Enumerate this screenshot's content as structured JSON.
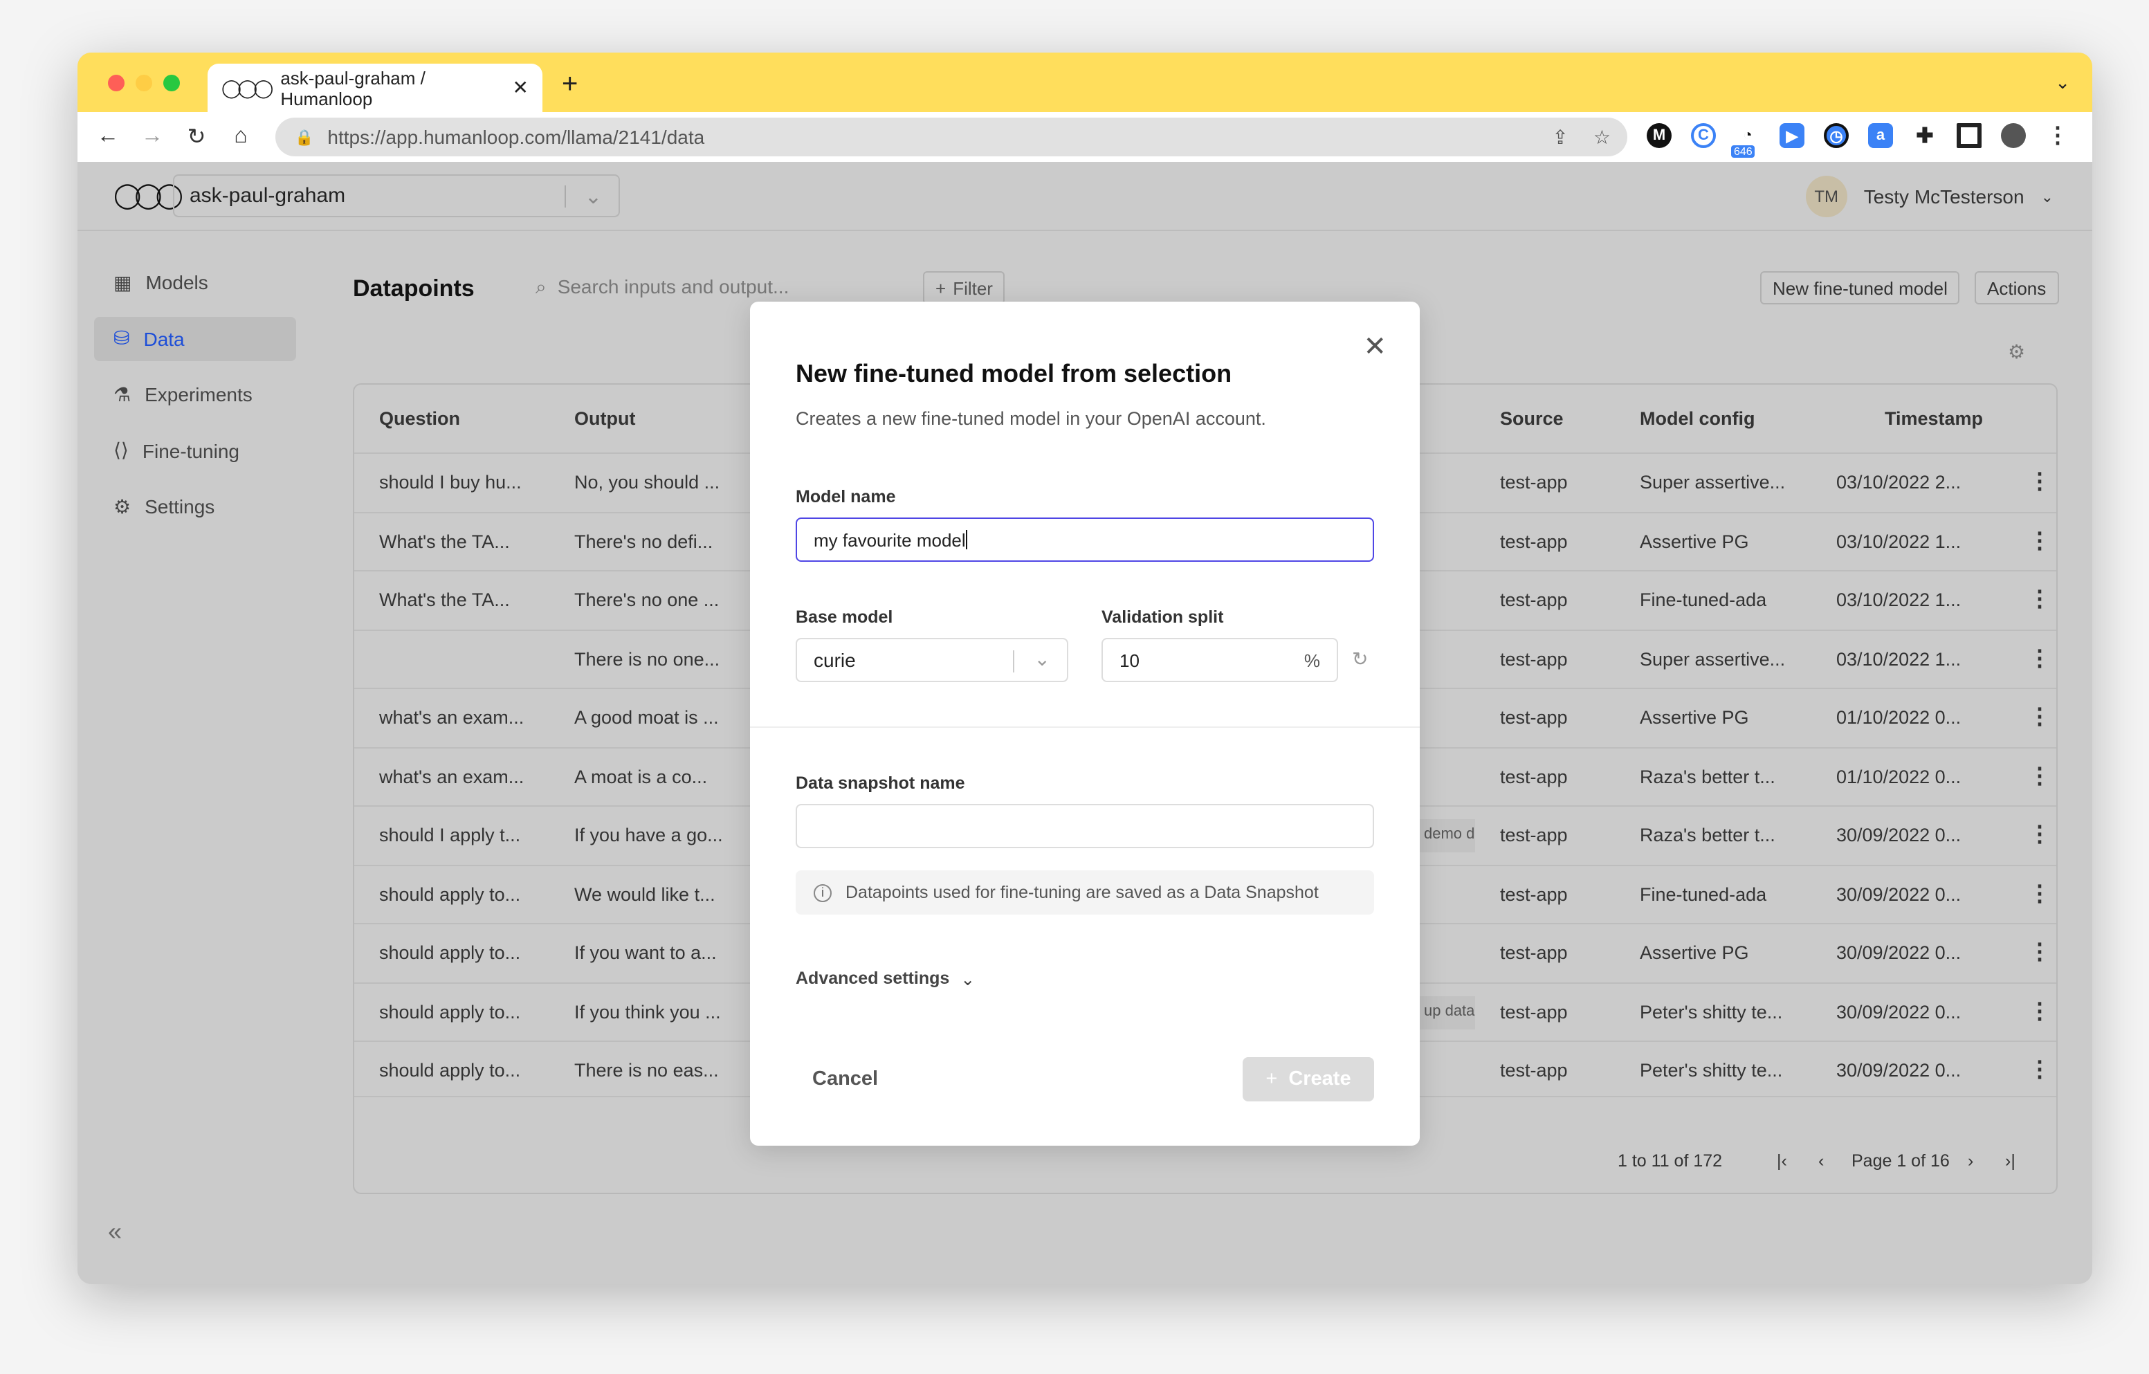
{
  "browser": {
    "tab_title": "ask-paul-graham / Humanloop",
    "url": "https://app.humanloop.com/llama/2141/data",
    "extension_badge": "646"
  },
  "header": {
    "project": "ask-paul-graham",
    "user_initials": "TM",
    "user_name": "Testy McTesterson"
  },
  "sidebar": {
    "items": [
      {
        "label": "Models",
        "icon": "grid-icon"
      },
      {
        "label": "Data",
        "icon": "database-icon",
        "active": true
      },
      {
        "label": "Experiments",
        "icon": "flask-icon"
      },
      {
        "label": "Fine-tuning",
        "icon": "finetune-icon"
      },
      {
        "label": "Settings",
        "icon": "gear-icon"
      }
    ]
  },
  "main": {
    "title": "Datapoints",
    "search_placeholder": "Search inputs and output...",
    "filter_label": "Filter",
    "new_model_label": "New fine-tuned model",
    "actions_label": "Actions"
  },
  "table": {
    "columns": [
      "Question",
      "Output",
      "Source",
      "Model config",
      "Timestamp"
    ],
    "rows": [
      {
        "question": "should I buy hu...",
        "output": "No, you should ...",
        "tag": "",
        "source": "test-app",
        "config": "Super assertive...",
        "timestamp": "03/10/2022 2..."
      },
      {
        "question": "What's the TA...",
        "output": "There's no defi...",
        "tag": "",
        "source": "test-app",
        "config": "Assertive PG",
        "timestamp": "03/10/2022 1..."
      },
      {
        "question": "What's the TA...",
        "output": "There's no one ...",
        "tag": "",
        "source": "test-app",
        "config": "Fine-tuned-ada",
        "timestamp": "03/10/2022 1..."
      },
      {
        "question": "",
        "output": "There is no one...",
        "tag": "",
        "source": "test-app",
        "config": "Super assertive...",
        "timestamp": "03/10/2022 1..."
      },
      {
        "question": "what's an exam...",
        "output": "A good moat is ...",
        "tag": "",
        "source": "test-app",
        "config": "Assertive PG",
        "timestamp": "01/10/2022 0..."
      },
      {
        "question": "what's an exam...",
        "output": "A moat is a co...",
        "tag": "",
        "source": "test-app",
        "config": "Raza's better t...",
        "timestamp": "01/10/2022 0..."
      },
      {
        "question": "should I apply t...",
        "output": "If you have a go...",
        "tag": "demo d",
        "source": "test-app",
        "config": "Raza's better t...",
        "timestamp": "30/09/2022 0..."
      },
      {
        "question": "should apply to...",
        "output": "We would like t...",
        "tag": "",
        "source": "test-app",
        "config": "Fine-tuned-ada",
        "timestamp": "30/09/2022 0..."
      },
      {
        "question": "should apply to...",
        "output": "If you want to a...",
        "tag": "",
        "source": "test-app",
        "config": "Assertive PG",
        "timestamp": "30/09/2022 0..."
      },
      {
        "question": "should apply to...",
        "output": "If you think you ...",
        "tag": "up data",
        "source": "test-app",
        "config": "Peter's shitty te...",
        "timestamp": "30/09/2022 0..."
      },
      {
        "question": "should apply to...",
        "output": "There is no eas...",
        "tag": "",
        "source": "test-app",
        "config": "Peter's shitty te...",
        "timestamp": "30/09/2022 0..."
      }
    ],
    "pagination": {
      "range": "1 to 11 of 172",
      "page": "Page 1 of 16"
    }
  },
  "dialog": {
    "title": "New fine-tuned model from selection",
    "subtitle": "Creates a new fine-tuned model in your OpenAI account.",
    "model_name_label": "Model name",
    "model_name_value": "my favourite model",
    "base_model_label": "Base model",
    "base_model_value": "curie",
    "validation_label": "Validation split",
    "validation_value": "10",
    "validation_unit": "%",
    "snapshot_label": "Data snapshot name",
    "snapshot_value": "",
    "info": "Datapoints used for fine-tuning are saved as a Data Snapshot",
    "advanced": "Advanced settings",
    "cancel": "Cancel",
    "create": "Create"
  }
}
